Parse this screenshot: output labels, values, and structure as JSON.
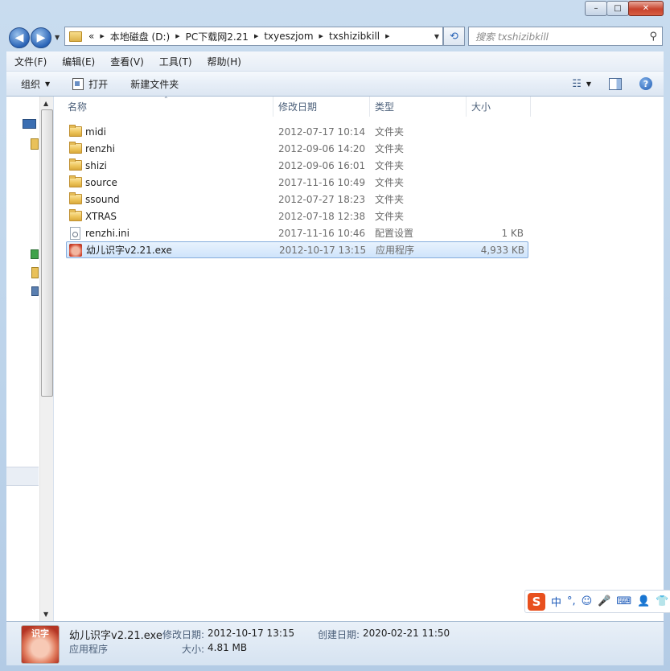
{
  "window": {
    "minimize_glyph": "–",
    "maximize_glyph": "□",
    "close_glyph": "✕"
  },
  "nav": {
    "back_glyph": "◀",
    "forward_glyph": "▶",
    "breadcrumb_prefix": "«",
    "breadcrumbs": [
      "本地磁盘 (D:)",
      "PC下载网2.21",
      "txyeszjom",
      "txshizibkill"
    ],
    "search_placeholder": "搜索 txshizibkill"
  },
  "menu": [
    "文件(F)",
    "编辑(E)",
    "查看(V)",
    "工具(T)",
    "帮助(H)"
  ],
  "toolbar": {
    "organize": "组织",
    "open": "打开",
    "new_folder": "新建文件夹",
    "help": "?"
  },
  "columns": {
    "name": "名称",
    "date": "修改日期",
    "type": "类型",
    "size": "大小"
  },
  "files": [
    {
      "name": "midi",
      "date": "2012-07-17 10:14",
      "type": "文件夹",
      "size": "",
      "icon": "folder-icon"
    },
    {
      "name": "renzhi",
      "date": "2012-09-06 14:20",
      "type": "文件夹",
      "size": "",
      "icon": "folder-icon"
    },
    {
      "name": "shizi",
      "date": "2012-09-06 16:01",
      "type": "文件夹",
      "size": "",
      "icon": "folder-icon"
    },
    {
      "name": "source",
      "date": "2017-11-16 10:49",
      "type": "文件夹",
      "size": "",
      "icon": "folder-icon"
    },
    {
      "name": "ssound",
      "date": "2012-07-27 18:23",
      "type": "文件夹",
      "size": "",
      "icon": "folder-icon"
    },
    {
      "name": "XTRAS",
      "date": "2012-07-18 12:38",
      "type": "文件夹",
      "size": "",
      "icon": "folder-icon"
    },
    {
      "name": "renzhi.ini",
      "date": "2017-11-16 10:46",
      "type": "配置设置",
      "size": "1 KB",
      "icon": "settings-file-icon"
    },
    {
      "name": "幼儿识字v2.21.exe",
      "date": "2012-10-17 13:15",
      "type": "应用程序",
      "size": "4,933 KB",
      "icon": "exe-icon",
      "selected": true
    }
  ],
  "details": {
    "thumb_text": "识字",
    "file_name": "幼儿识字v2.21.exe",
    "modified_label": "修改日期:",
    "modified_value": "2012-10-17 13:15",
    "created_label": "创建日期:",
    "created_value": "2020-02-21 11:50",
    "type_value": "应用程序",
    "size_label": "大小:",
    "size_value": "4.81 MB"
  },
  "ime": {
    "logo": "S",
    "mode": "中",
    "punct": "°,",
    "emoji": "☺",
    "voice": "🎤",
    "keyboard": "⌨",
    "user": "👤",
    "skin": "👕"
  }
}
